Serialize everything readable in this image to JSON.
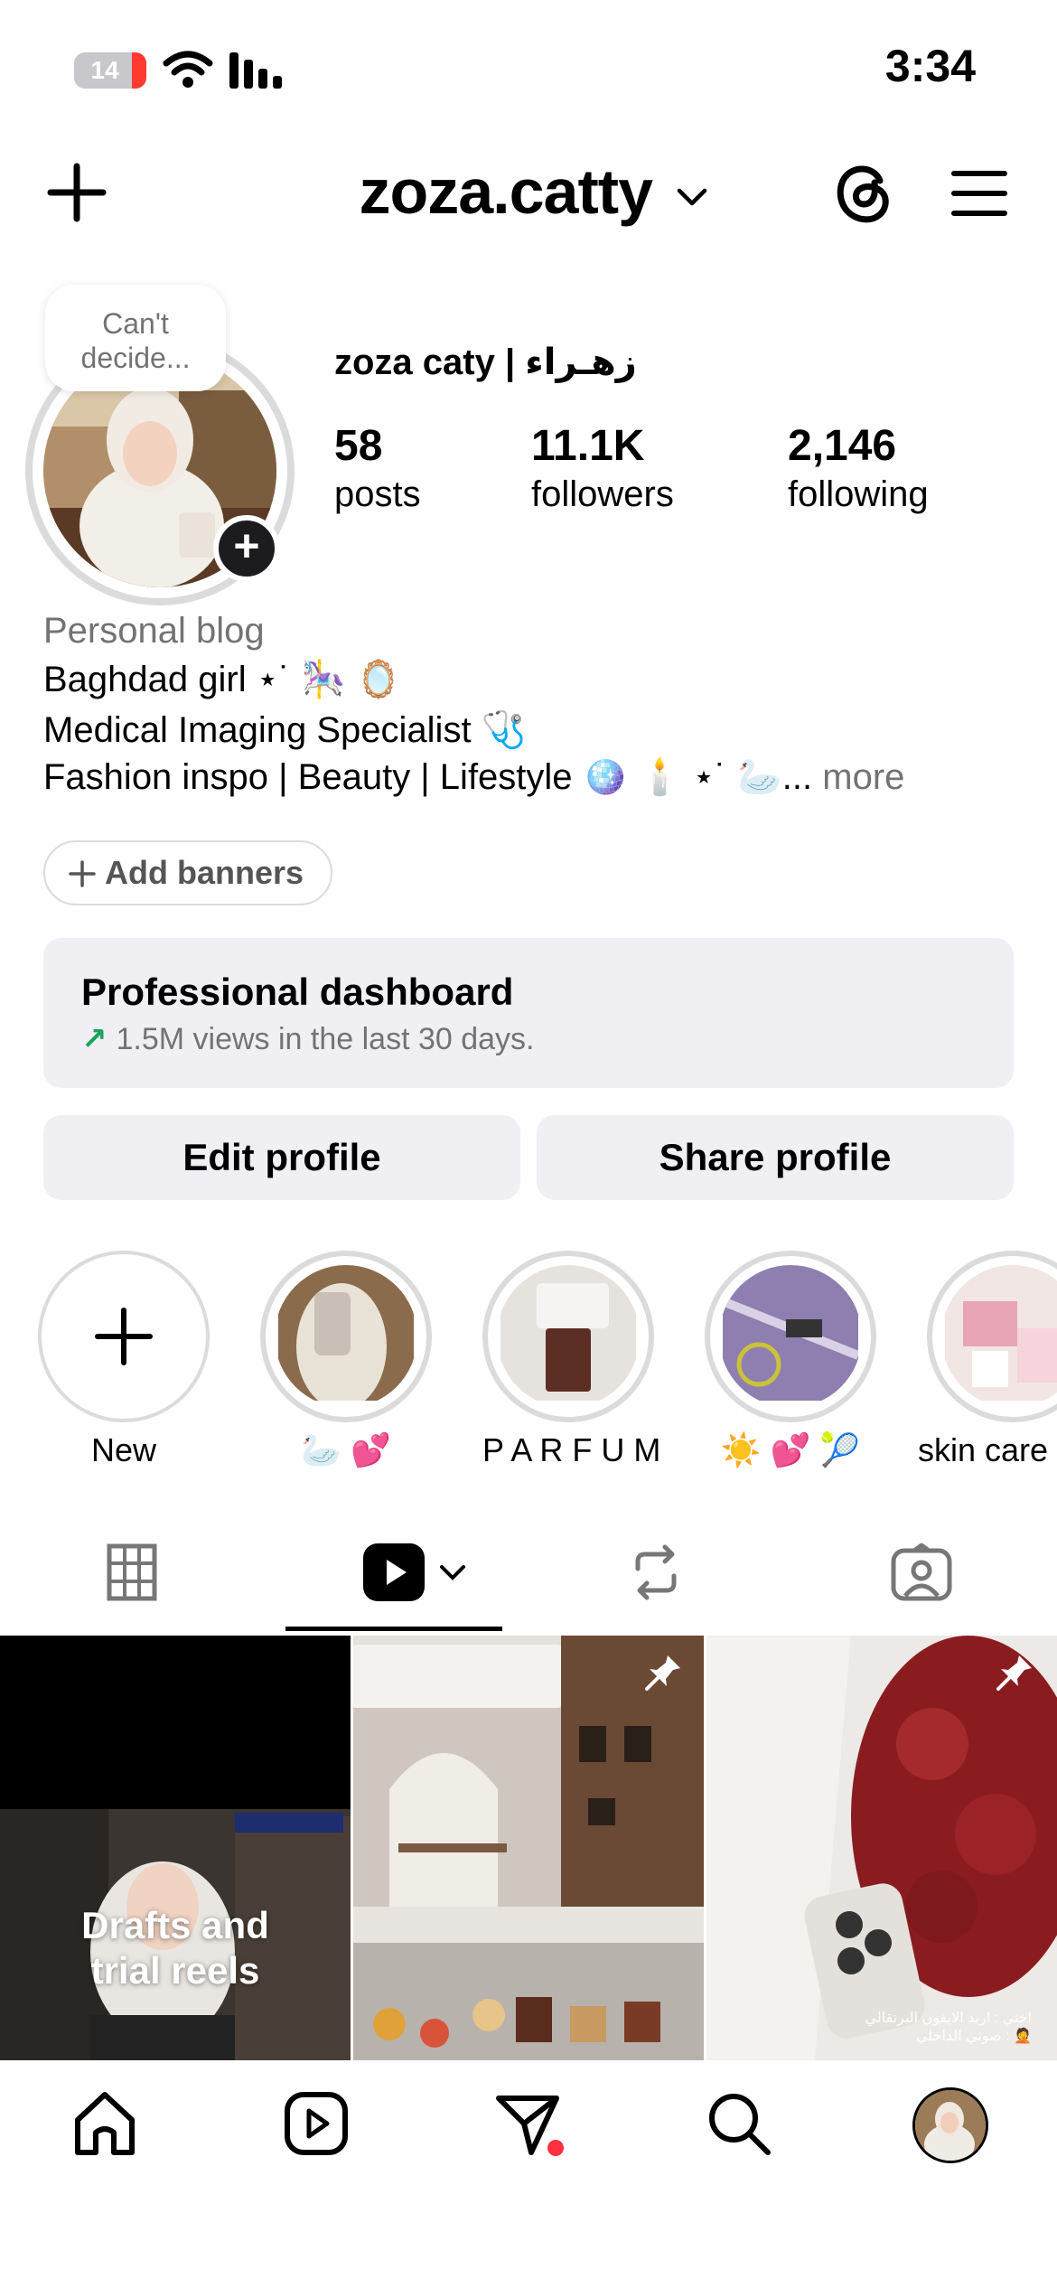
{
  "status_bar": {
    "battery": "14",
    "time": "3:34"
  },
  "header": {
    "username": "zoza.catty"
  },
  "profile": {
    "note": "Can't decide...",
    "display_name": "zoza caty | زهـراء",
    "stats": [
      {
        "value": "58",
        "label": "posts"
      },
      {
        "value": "11.1K",
        "label": "followers"
      },
      {
        "value": "2,146",
        "label": "following"
      }
    ]
  },
  "bio": {
    "category": "Personal blog",
    "lines": [
      "Baghdad girl ⋆˙ 🎠 🪞",
      "Medical Imaging Specialist 🩺",
      "Fashion inspo | Beauty | Lifestyle 🪩 🕯️ ⋆˙ 🦢..."
    ],
    "more": "more"
  },
  "add_banners": "Add banners",
  "dashboard": {
    "title": "Professional dashboard",
    "subtitle": "1.5M views in the last 30 days."
  },
  "buttons": {
    "edit": "Edit profile",
    "share": "Share profile"
  },
  "highlights": [
    {
      "label": "New"
    },
    {
      "label": "🦢 💕"
    },
    {
      "label": "P A R F U M"
    },
    {
      "label": "☀️ 💕 🎾"
    },
    {
      "label": "skin care"
    }
  ],
  "grid": {
    "drafts_label_line1": "Drafts and",
    "drafts_label_line2": "trial reels"
  },
  "icons": {
    "header": [
      "plus-icon",
      "chevron-down-icon",
      "threads-icon",
      "menu-icon"
    ],
    "tabs": [
      "grid-icon",
      "reels-icon",
      "reposts-icon",
      "tagged-icon"
    ],
    "nav": [
      "home-icon",
      "reels-icon",
      "send-icon",
      "search-icon",
      "profile-avatar"
    ]
  },
  "colors": {
    "accent_green": "#1aa35a",
    "notification_dot": "#ff3040",
    "muted": "#737373"
  }
}
